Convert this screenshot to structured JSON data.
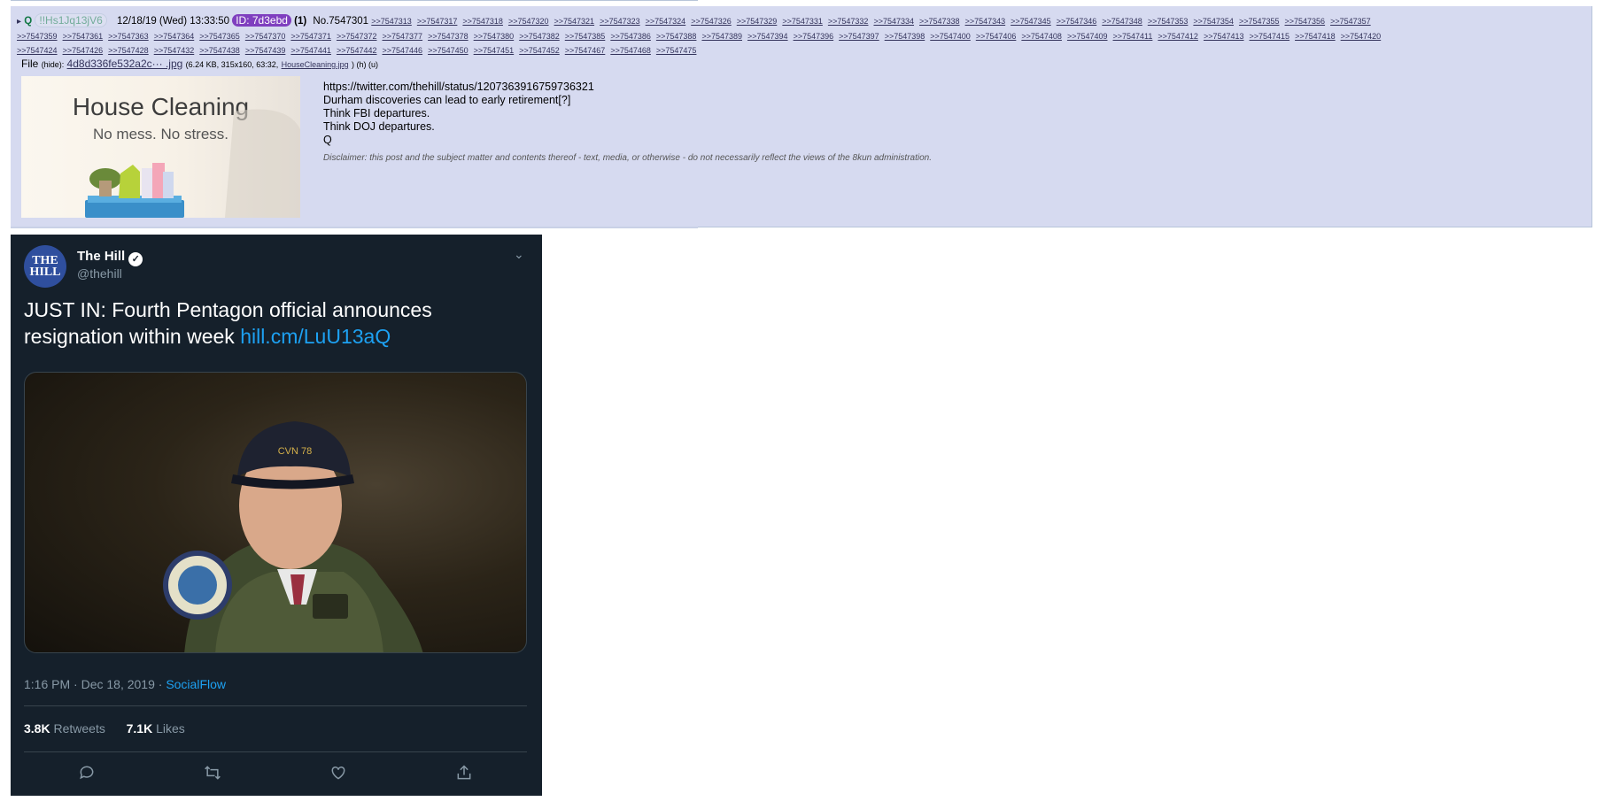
{
  "post": {
    "arrow": "▸",
    "name": "Q",
    "tripcode": "!!Hs1Jq13jV6",
    "date": "12/18/19 (Wed) 13:33:50",
    "id_badge": "ID: 7d3ebd",
    "post_count": "(1)",
    "post_no": "No.7547301",
    "replies_line1": [
      ">>7547313",
      ">>7547317",
      ">>7547318",
      ">>7547320",
      ">>7547321",
      ">>7547323",
      ">>7547324",
      ">>7547326",
      ">>7547329",
      ">>7547331",
      ">>7547332",
      ">>7547334",
      ">>7547338",
      ">>7547343",
      ">>7547345",
      ">>7547346",
      ">>7547348",
      ">>7547353",
      ">>7547354",
      ">>7547355",
      ">>7547356",
      ">>7547357"
    ],
    "replies_line2": [
      ">>7547359",
      ">>7547361",
      ">>7547363",
      ">>7547364",
      ">>7547365",
      ">>7547370",
      ">>7547371",
      ">>7547372",
      ">>7547377",
      ">>7547378",
      ">>7547380",
      ">>7547382",
      ">>7547385",
      ">>7547386",
      ">>7547388",
      ">>7547389",
      ">>7547394",
      ">>7547396",
      ">>7547397",
      ">>7547398",
      ">>7547400",
      ">>7547406",
      ">>7547408",
      ">>7547409",
      ">>7547411",
      ">>7547412",
      ">>7547413",
      ">>7547415",
      ">>7547418",
      ">>7547420"
    ],
    "replies_line3": [
      ">>7547424",
      ">>7547426",
      ">>7547428",
      ">>7547432",
      ">>7547438",
      ">>7547439",
      ">>7547441",
      ">>7547442",
      ">>7547446",
      ">>7547450",
      ">>7547451",
      ">>7547452",
      ">>7547467",
      ">>7547468",
      ">>7547475"
    ],
    "file_label": "File",
    "file_hide": "(hide):",
    "file_name": "4d8d336fe532a2c··· .jpg",
    "file_info": "(6.24 KB, 315x160, 63:32,",
    "file_orig": "HouseCleaning.jpg",
    "file_links": ") (h) (u)",
    "thumb_title": "House Cleaning",
    "thumb_subtitle": "No mess. No stress.",
    "body_lines": [
      "https://twitter.com/thehill/status/1207363916759736321",
      "Durham discoveries can lead to early retirement[?]",
      "Think FBI departures.",
      "Think DOJ departures.",
      "Q"
    ],
    "disclaimer": "Disclaimer: this post and the subject matter and contents thereof - text, media, or otherwise - do not necessarily reflect the views of the 8kun administration."
  },
  "tweet": {
    "avatar_text": "THE HILL",
    "author": "The Hill",
    "handle": "@thehill",
    "text": "JUST IN: Fourth Pentagon official announces resignation within week",
    "link": "hill.cm/LuU13aQ",
    "timestamp": "1:16 PM · Dec 18, 2019 ·",
    "source": "SocialFlow",
    "retweets_count": "3.8K",
    "retweets_label": "Retweets",
    "likes_count": "7.1K",
    "likes_label": "Likes"
  },
  "colors": {
    "post_bg": "#d6daf0",
    "tweet_bg": "#15202b",
    "link_blue": "#1da1f2",
    "id_purple": "#7f3fbf"
  }
}
